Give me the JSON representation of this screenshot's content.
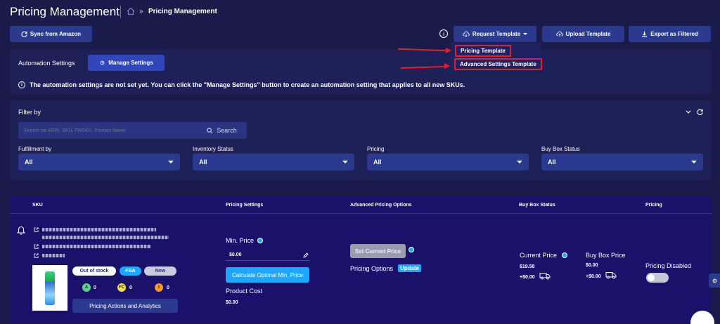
{
  "header": {
    "title": "Pricing Management",
    "breadcrumb_arrow": "»",
    "breadcrumb_current": "Pricing Management"
  },
  "toolbar": {
    "sync": "Sync from Amazon",
    "info_symbol": "i",
    "request_template": "Request Template",
    "upload_template": "Upload Template",
    "export_filtered": "Export as Filtered"
  },
  "dropdown": {
    "items": [
      "Pricing Template",
      "Advanced Settings Template"
    ]
  },
  "automation": {
    "label": "Automation Settings",
    "manage": "Manage Settings",
    "notice": "The automation settings are not set yet. You can click the \"Manage Settings\" button to create an automation setting that applies to all new SKUs."
  },
  "filter": {
    "title": "Filter by",
    "search_placeholder": "Search for ASIN, SKU, FNSKU, Product Name",
    "search_button": "Search",
    "fields": [
      {
        "label": "Fulfillment by",
        "value": "All"
      },
      {
        "label": "Inventory Status",
        "value": "All"
      },
      {
        "label": "Pricing",
        "value": "All"
      },
      {
        "label": "Buy Box Status",
        "value": "All"
      }
    ]
  },
  "table": {
    "headers": [
      "SKU",
      "Pricing Settings",
      "Advanced Pricing Options",
      "Buy Box Status",
      "Pricing"
    ],
    "row": {
      "badges": [
        "Out of stock",
        "FBA",
        "New"
      ],
      "counts": [
        {
          "letter": "A",
          "value": "0",
          "color": "#5fd18a"
        },
        {
          "letter": "FC",
          "value": "0",
          "color": "#f3e04a"
        },
        {
          "letter": "I",
          "value": "0",
          "color": "#f39a2e"
        }
      ],
      "actions": "Pricing Actions and Analytics",
      "min_price_label": "Min. Price",
      "min_price_value": "$0.00",
      "calc_button": "Calculate Optimal Min. Price",
      "product_cost_label": "Product Cost",
      "product_cost_value": "$0.00",
      "set_current": "Set Current Price",
      "pricing_options": "Pricing Options",
      "update": "Update",
      "current_price_label": "Current Price",
      "current_price_value": "$19.58",
      "current_price_ship": "+$0.00",
      "buybox_price_label": "Buy Box Price",
      "buybox_price_value": "$0.00",
      "buybox_price_ship": "+$0.00",
      "pricing_status": "Pricing Disabled"
    }
  },
  "colors": {
    "background": "#1a1b4b",
    "button": "#2b3a8f",
    "accent": "#1ea7ff",
    "highlight": "#e0202a"
  }
}
